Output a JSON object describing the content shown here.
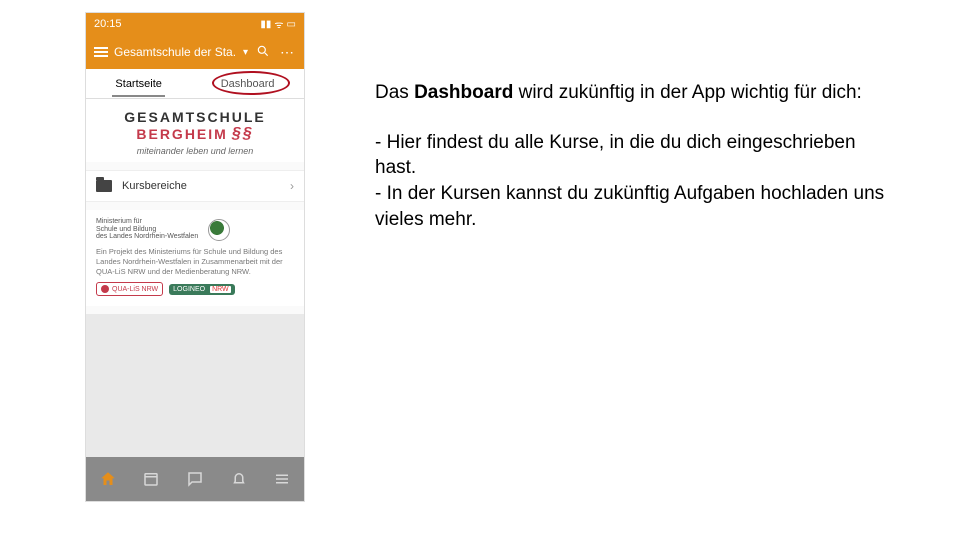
{
  "phone": {
    "status": {
      "time": "20:15",
      "signal_icon": "signal-icon",
      "wifi_icon": "wifi-icon",
      "battery_icon": "battery-icon"
    },
    "appbar": {
      "title": "Gesamtschule der Sta...",
      "menu_icon": "hamburger-icon",
      "chevron_icon": "chevron-down-icon",
      "search_icon": "search-icon",
      "more_icon": "more-icon"
    },
    "tabs": {
      "items": [
        {
          "label": "Startseite",
          "active": true
        },
        {
          "label": "Dashboard",
          "active": false
        }
      ]
    },
    "school": {
      "line1": "GESAMTSCHULE",
      "line2": "BERGHEIM",
      "swoosh": "§§",
      "tagline": "miteinander leben und lernen"
    },
    "kursbereiche": {
      "label": "Kursbereiche",
      "folder_icon": "folder-icon",
      "chevron_icon": "chevron-right-icon"
    },
    "ministry": {
      "name_line1": "Ministerium für",
      "name_line2": "Schule und Bildung",
      "name_line3": "des Landes Nordrhein-Westfalen",
      "nrw_logo": "nrw-coat-icon",
      "paragraph": "Ein Projekt des Ministeriums für Schule und Bildung des Landes Nordrhein-Westfalen in Zusammenarbeit mit der QUA-LiS NRW und der Medienberatung NRW.",
      "logo_qua": "QUA-LiS NRW",
      "logo_logineo": "LOGINEO",
      "logo_logineo_nrw": "NRW"
    },
    "bottomnav": {
      "items": [
        {
          "name": "home-icon",
          "active": true
        },
        {
          "name": "calendar-icon",
          "active": false
        },
        {
          "name": "chat-icon",
          "active": false
        },
        {
          "name": "bell-icon",
          "active": false
        },
        {
          "name": "menu-icon",
          "active": false
        }
      ]
    }
  },
  "explain": {
    "p1_pre": "Das ",
    "p1_bold": "Dashboard",
    "p1_post": " wird zukünftig in der App wichtig für dich:",
    "b1": "- Hier findest du alle Kurse, in die du dich eingeschrieben hast.",
    "b2": "- In der Kursen kannst du zukünftig Aufgaben hochladen uns vieles mehr."
  },
  "annotation": {
    "circle": "dashboard-tab-highlight"
  }
}
